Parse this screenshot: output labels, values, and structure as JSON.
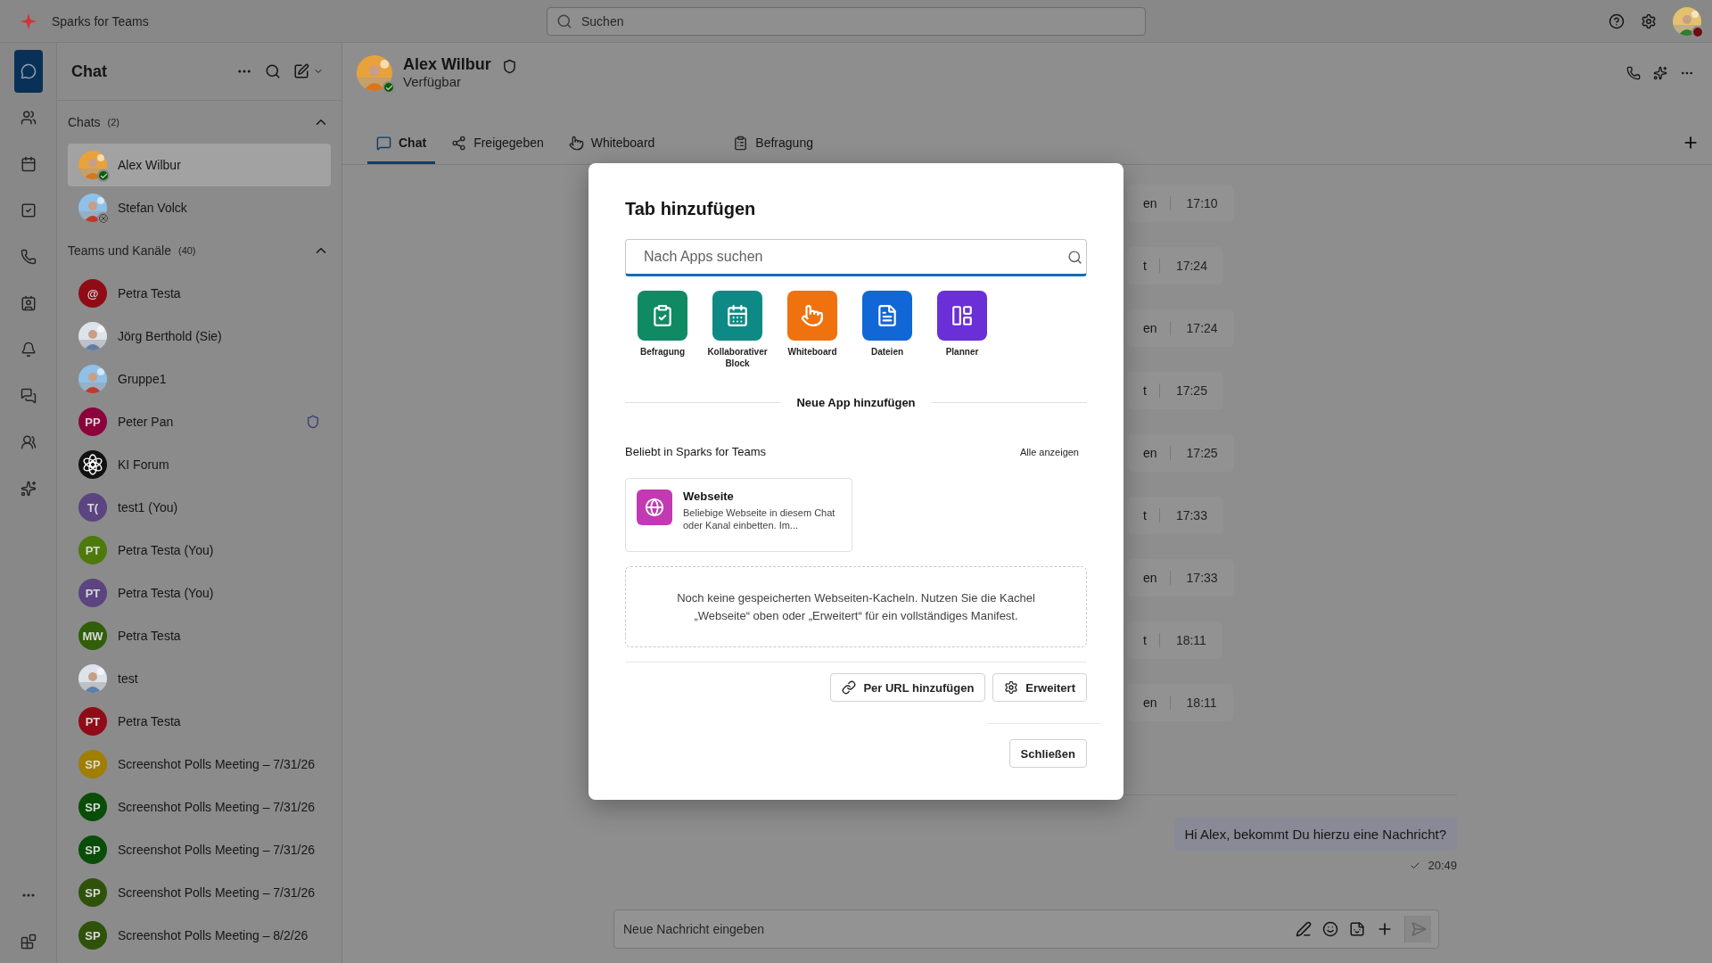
{
  "app": {
    "title": "Sparks for Teams"
  },
  "search": {
    "placeholder": "Suchen"
  },
  "rail": [
    {
      "selected": true
    },
    {
      "selected": false
    },
    {
      "selected": false
    },
    {
      "selected": false
    },
    {
      "selected": false
    },
    {
      "selected": false
    },
    {
      "selected": false
    },
    {
      "selected": false
    },
    {
      "selected": false
    },
    {
      "selected": false
    }
  ],
  "chat_list": {
    "title": "Chat",
    "sections": [
      {
        "title": "Chats",
        "count": "(2)",
        "expanded": true,
        "items": [
          {
            "name": "Alex Wilbur",
            "online": true,
            "selected": true,
            "shielded": false
          },
          {
            "name": "Stefan Volck",
            "online": false,
            "selected": false,
            "shielded": false
          }
        ]
      },
      {
        "title": "Teams und Kanäle",
        "count": "(40)",
        "expanded": true,
        "items": [
          {
            "name": "Petra Testa",
            "kind": "initials",
            "initials": "@",
            "color": "#8f0c17",
            "selected": false,
            "shielded": false
          },
          {
            "name": "Jörg Berthold (Sie)",
            "selected": false,
            "shielded": false
          },
          {
            "name": "Gruppe1",
            "selected": false,
            "shielded": false
          },
          {
            "name": "Peter Pan",
            "kind": "initials",
            "initials": "PP",
            "color": "#8c003c",
            "selected": false,
            "shielded": true
          },
          {
            "name": "KI Forum",
            "kind": "logo",
            "selected": false,
            "shielded": false
          },
          {
            "name": "test1 (You)",
            "kind": "initials",
            "initials": "T(",
            "color": "#5b4480",
            "selected": false,
            "shielded": false
          },
          {
            "name": "Petra Testa (You)",
            "kind": "initials",
            "initials": "PT",
            "color": "#4d7a0a",
            "selected": false,
            "shielded": false
          },
          {
            "name": "Petra Testa (You)",
            "kind": "initials",
            "initials": "PT",
            "color": "#5b4480",
            "selected": false,
            "shielded": false
          },
          {
            "name": "Petra Testa",
            "kind": "initials",
            "initials": "MW",
            "color": "#305e09",
            "selected": false,
            "shielded": false
          },
          {
            "name": "test",
            "selected": false,
            "shielded": false
          },
          {
            "name": "Petra Testa",
            "kind": "initials",
            "initials": "PT",
            "color": "#8f0c17",
            "selected": false,
            "shielded": false
          },
          {
            "name": "Screenshot Polls Meeting – 7/31/26",
            "kind": "initials",
            "initials": "SP",
            "color": "#a07e00",
            "selected": false,
            "shielded": false
          },
          {
            "name": "Screenshot Polls Meeting – 7/31/26",
            "kind": "initials",
            "initials": "SP",
            "color": "#084d08",
            "selected": false,
            "shielded": false
          },
          {
            "name": "Screenshot Polls Meeting – 7/31/26",
            "kind": "initials",
            "initials": "SP",
            "color": "#084d08",
            "selected": false,
            "shielded": false
          },
          {
            "name": "Screenshot Polls Meeting – 7/31/26",
            "kind": "initials",
            "initials": "SP",
            "color": "#2f520a",
            "selected": false,
            "shielded": false
          },
          {
            "name": "Screenshot Polls Meeting – 8/2/26",
            "kind": "initials",
            "initials": "SP",
            "color": "#2f520a",
            "selected": false,
            "shielded": false
          }
        ]
      }
    ]
  },
  "conversation": {
    "name": "Alex Wilbur",
    "status": "Verfügbar",
    "online": true,
    "tabs": [
      {
        "label": "Chat",
        "selected": true
      },
      {
        "label": "Freigegeben",
        "selected": false
      },
      {
        "label": "Whiteboard",
        "selected": false
      },
      {
        "label": "Befragung",
        "selected": false
      }
    ],
    "messages": [
      {
        "text": "en",
        "time": "17:10"
      },
      {
        "text": "t",
        "time": "17:24"
      },
      {
        "text": "en",
        "time": "17:24"
      },
      {
        "text": "t",
        "time": "17:25"
      },
      {
        "text": "en",
        "time": "17:25"
      },
      {
        "text": "t",
        "time": "17:33"
      },
      {
        "text": "en",
        "time": "17:33"
      },
      {
        "text": "t",
        "time": "18:11"
      },
      {
        "text": "en",
        "time": "18:11"
      }
    ],
    "sent": {
      "text": "Hi Alex, bekommt Du hierzu eine Nachricht?",
      "time": "20:49"
    },
    "composer": {
      "placeholder": "Neue Nachricht eingeben"
    }
  },
  "dialog": {
    "title": "Tab hinzufügen",
    "search": {
      "placeholder": "Nach Apps suchen"
    },
    "apps": [
      {
        "label": "Befragung",
        "color": "#0f8a63"
      },
      {
        "label": "Kollaborativer Block",
        "color": "#0e8a86"
      },
      {
        "label": "Whiteboard",
        "color": "#f0720f"
      },
      {
        "label": "Dateien",
        "color": "#1167d6"
      },
      {
        "label": "Planner",
        "color": "#6a2fd6"
      }
    ],
    "divider_label": "Neue App hinzufügen",
    "popular": {
      "title": "Beliebt in Sparks for Teams",
      "link": "Alle anzeigen",
      "cards": [
        {
          "title": "Webseite",
          "description": "Beliebige Webseite in diesem Chat oder Kanal einbetten. Im..."
        }
      ]
    },
    "empty_note": "Noch keine gespeicherten Webseiten-Kacheln. Nutzen Sie die Kachel „Webseite“ oben oder „Erweitert“ für ein vollständiges Manifest.",
    "buttons": [
      {
        "label": "Per URL hinzufügen"
      },
      {
        "label": "Erweitert"
      }
    ],
    "close": "Schließen"
  }
}
